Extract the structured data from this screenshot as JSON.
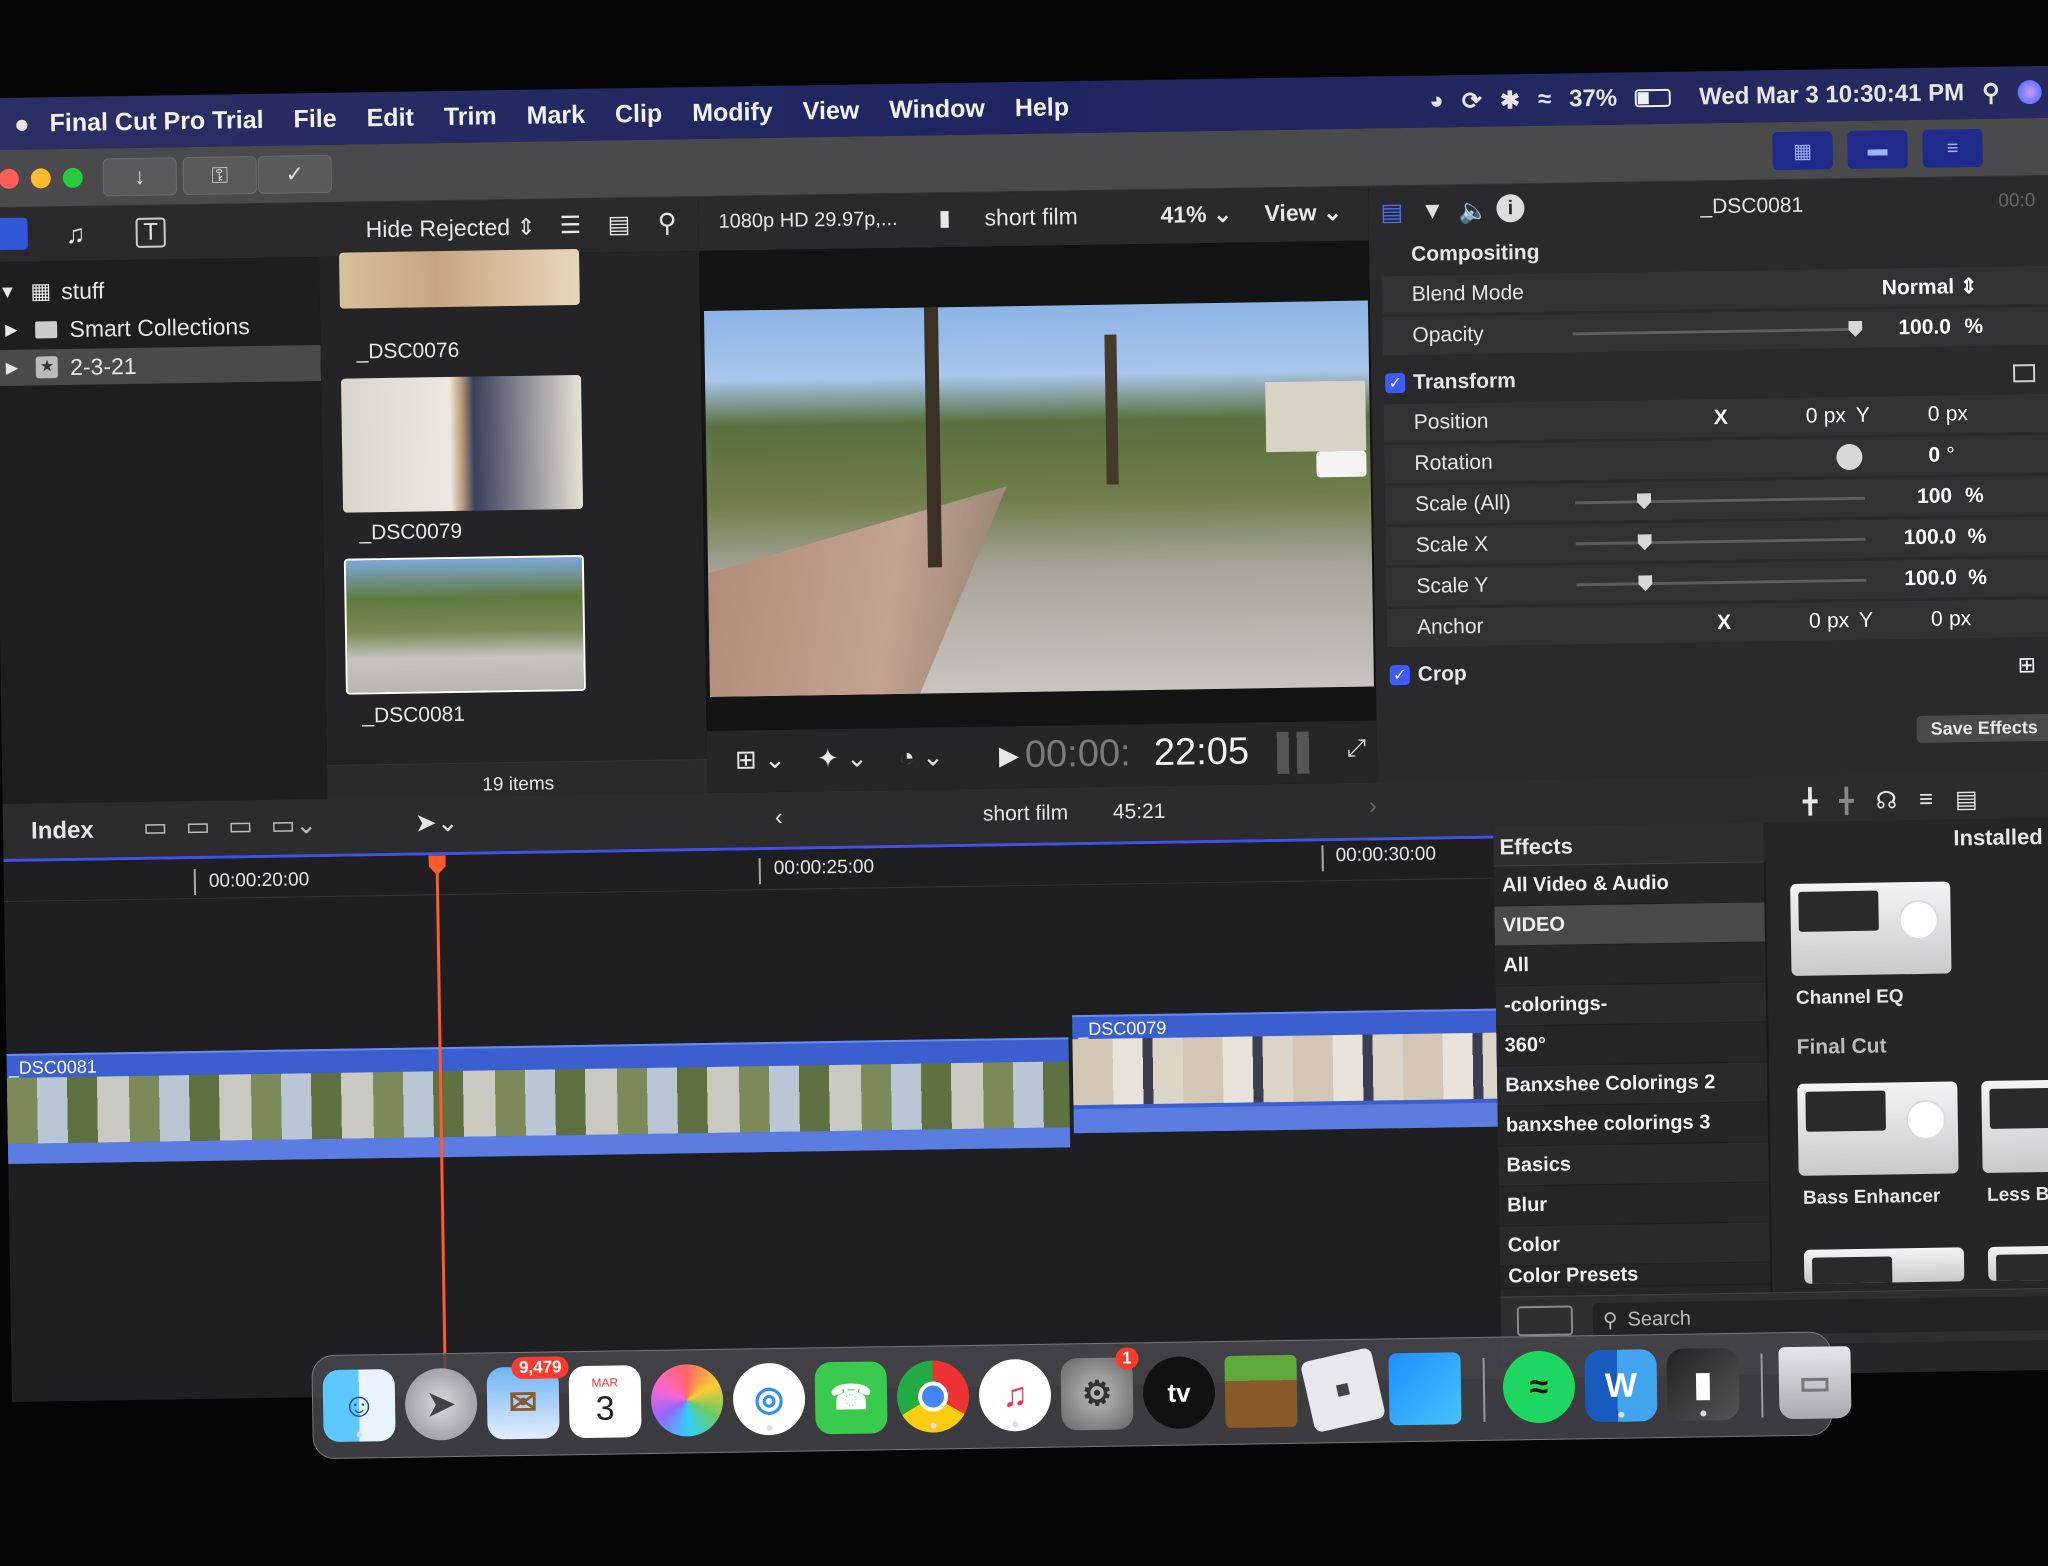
{
  "menubar": {
    "app": "Final Cut Pro Trial",
    "items": [
      "File",
      "Edit",
      "Trim",
      "Mark",
      "Clip",
      "Modify",
      "View",
      "Window",
      "Help"
    ],
    "battery": "37%",
    "datetime": "Wed Mar 3  10:30:41 PM"
  },
  "library": {
    "hide_rejected": "Hide Rejected",
    "rows": [
      {
        "label": "stuff"
      },
      {
        "label": "Smart Collections"
      },
      {
        "label": "2-3-21"
      }
    ],
    "item_count": "19 items"
  },
  "browser": {
    "clips": [
      {
        "name": "_DSC0076"
      },
      {
        "name": "_DSC0079"
      },
      {
        "name": "_DSC0081"
      }
    ]
  },
  "viewer": {
    "format": "1080p HD 29.97p,...",
    "project": "short film",
    "zoom": "41%",
    "view_label": "View",
    "timecode_dim": "00:00:",
    "timecode": "22:05"
  },
  "inspector": {
    "clip_name": "_DSC0081",
    "time": "00:0",
    "compositing": "Compositing",
    "blend_mode_label": "Blend Mode",
    "blend_mode_value": "Normal",
    "opacity_label": "Opacity",
    "opacity_value": "100.0",
    "opacity_unit": "%",
    "transform": "Transform",
    "position_label": "Position",
    "position_x": "0",
    "position_y": "0",
    "px": "px",
    "x_label": "X",
    "y_label": "Y",
    "rotation_label": "Rotation",
    "rotation_value": "0",
    "degree": "°",
    "scale_all_label": "Scale (All)",
    "scale_all_value": "100",
    "scale_x_label": "Scale X",
    "scale_x_value": "100.0",
    "scale_y_label": "Scale Y",
    "scale_y_value": "100.0",
    "pct": "%",
    "anchor_label": "Anchor",
    "anchor_x": "0",
    "anchor_y": "0",
    "crop": "Crop",
    "save_effects": "Save Effects"
  },
  "timeline": {
    "index": "Index",
    "project": "short film",
    "duration": "45:21",
    "ruler": [
      "00:00:20:00",
      "00:00:25:00",
      "00:00:30:00"
    ],
    "clips": [
      {
        "name": "_DSC0081"
      },
      {
        "name": "_DSC0079"
      }
    ]
  },
  "effects": {
    "title": "Effects",
    "installed": "Installed E",
    "categories": [
      "All Video & Audio",
      "VIDEO",
      "All",
      "-colorings-",
      "360°",
      "Banxshee Colorings 2",
      "banxshee colorings 3",
      "Basics",
      "Blur",
      "Color",
      "Color Presets"
    ],
    "group": "Final Cut",
    "tiles": [
      "Channel EQ",
      "Bass Enhancer",
      "Less Ba"
    ],
    "search_placeholder": "Search"
  },
  "dock": {
    "mail_badge": "9,479",
    "calendar_month": "MAR",
    "calendar_day": "3",
    "settings_badge": "1",
    "tv_label": "tv",
    "word_label": "W"
  },
  "colors": {
    "accent": "#3d5bff",
    "playhead": "#ff5a2a",
    "clip_blue": "#3b5fcf"
  }
}
